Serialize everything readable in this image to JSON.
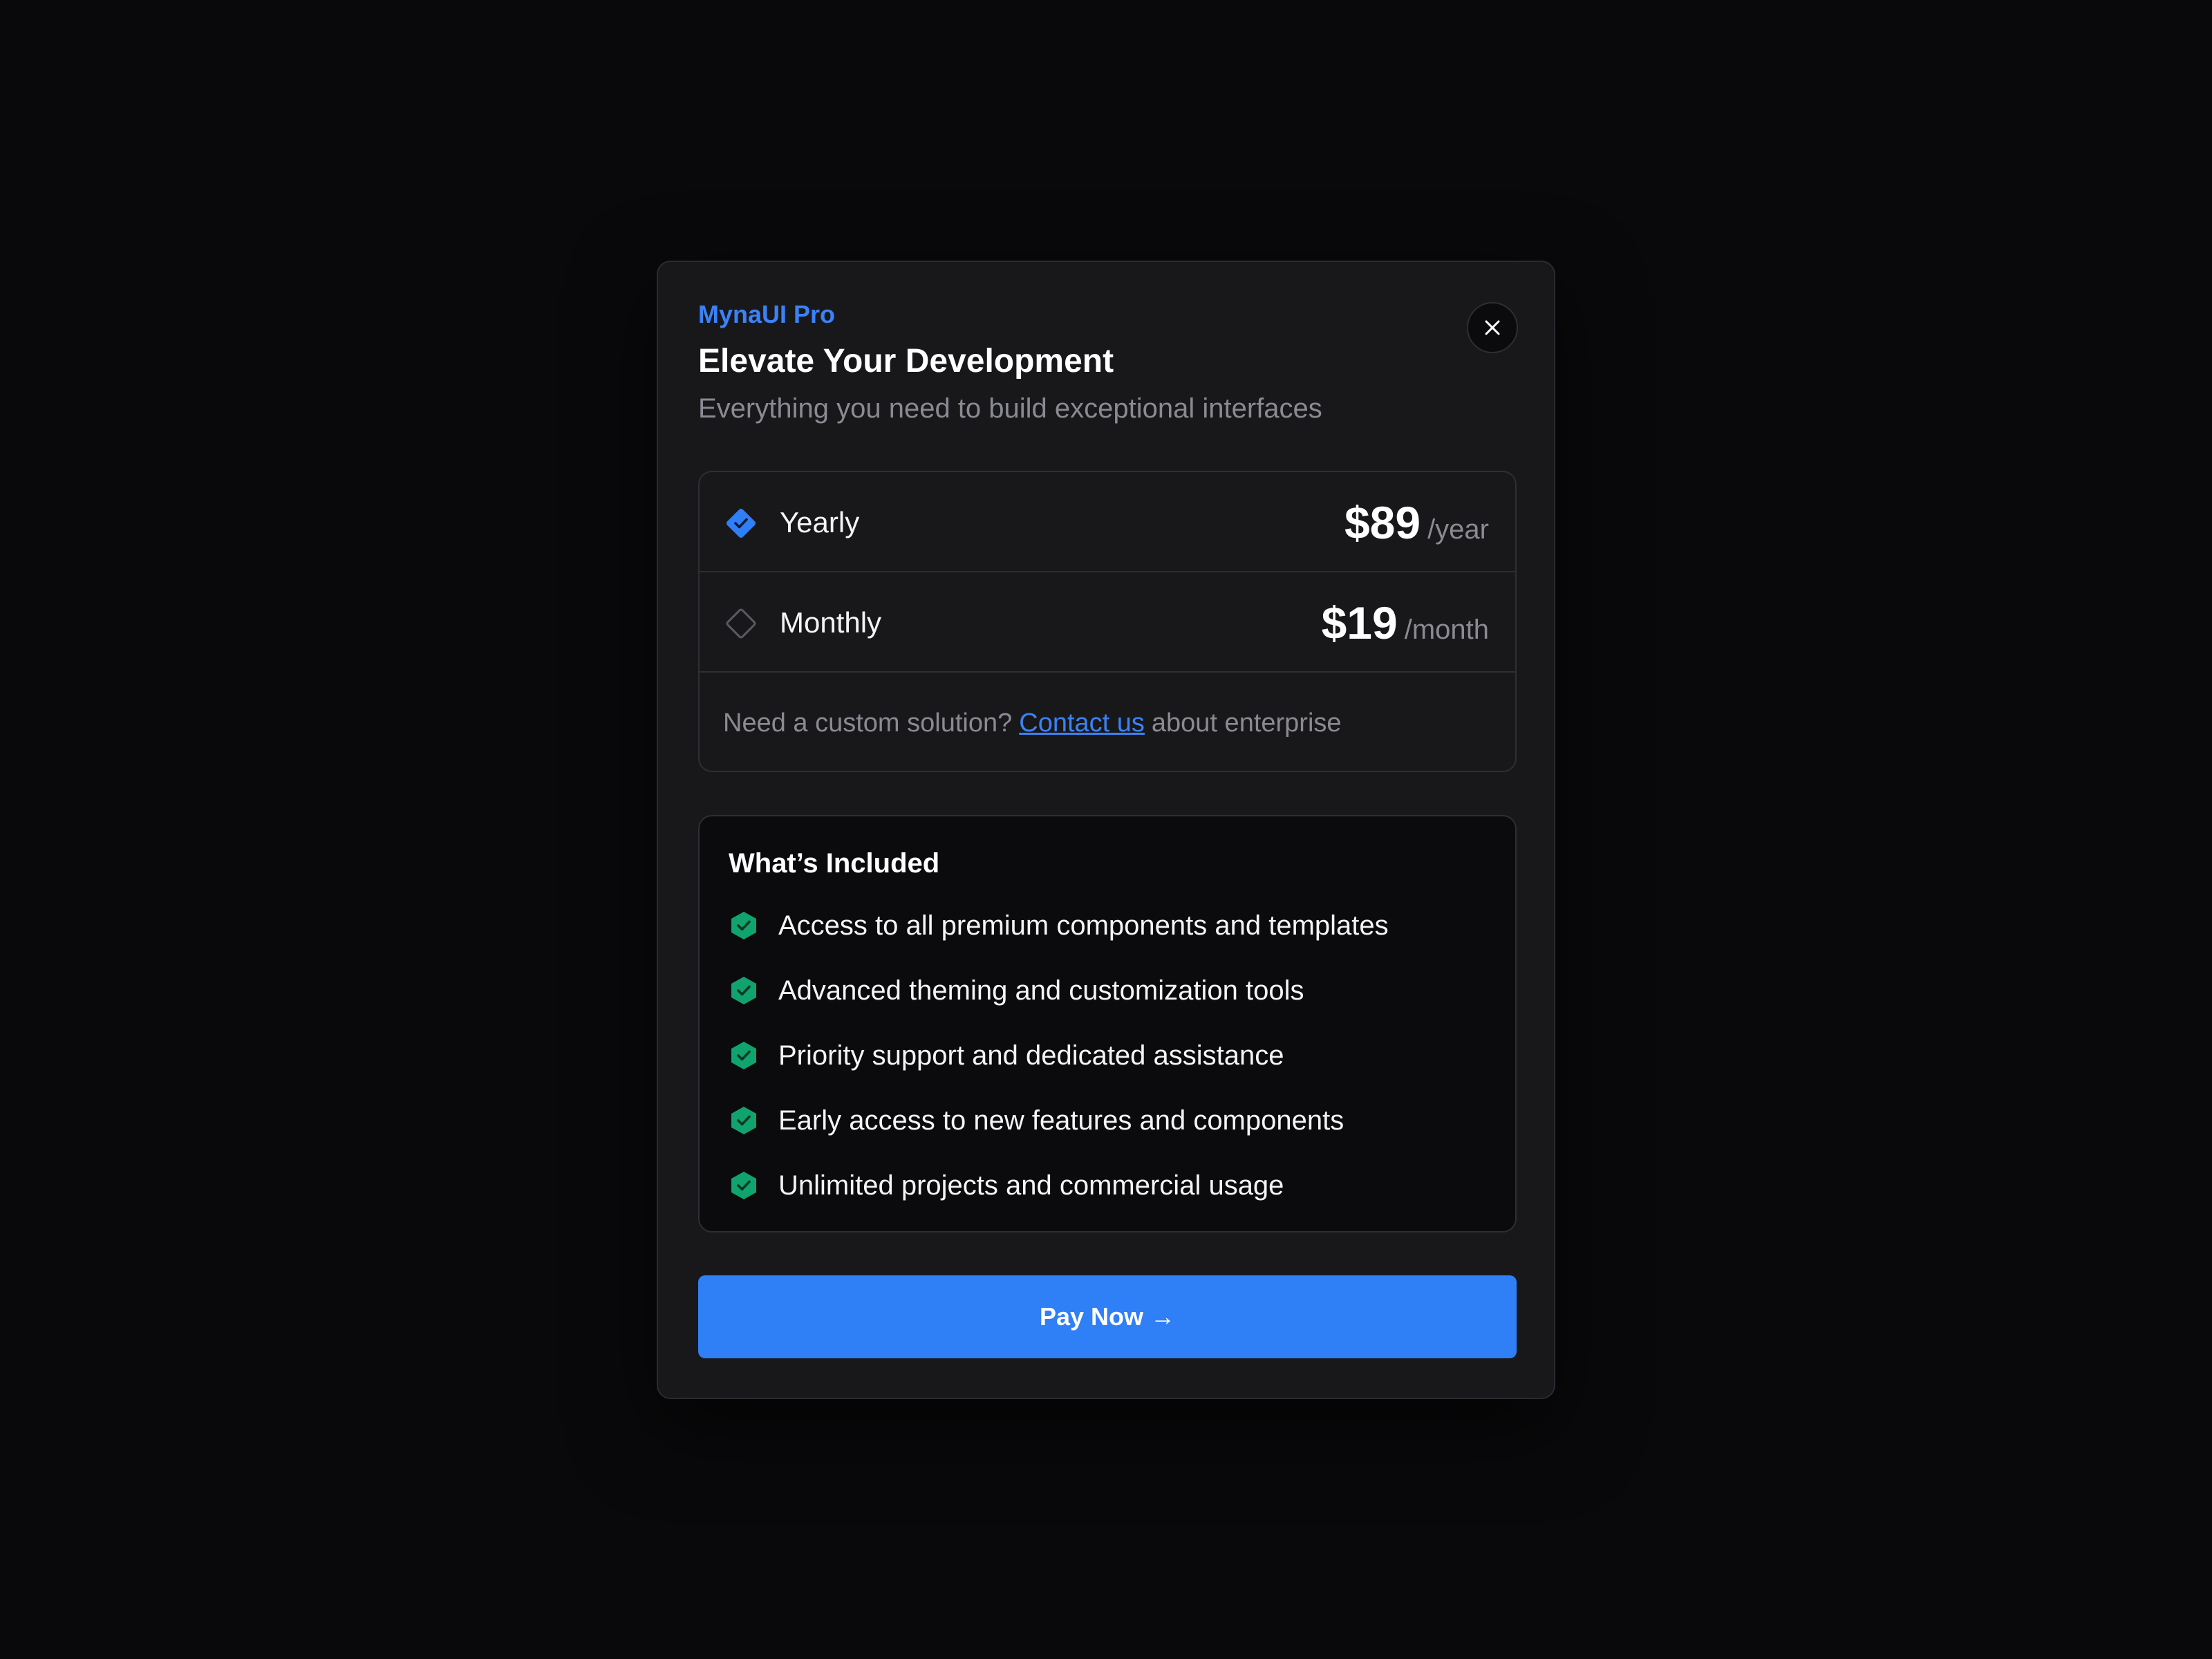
{
  "modal": {
    "brand": "MynaUI Pro",
    "title": "Elevate Your Development",
    "subtitle": "Everything you need to build exceptional interfaces",
    "close_icon": "x-icon"
  },
  "plans": [
    {
      "name": "Yearly",
      "price": "$89",
      "period": "/year",
      "selected": true
    },
    {
      "name": "Monthly",
      "price": "$19",
      "period": "/month",
      "selected": false
    }
  ],
  "custom": {
    "prefix": "Need a custom solution?",
    "link": "Contact us",
    "suffix": "about enterprise"
  },
  "included": {
    "title": "What’s Included",
    "icon": "shield-check-icon",
    "items": [
      "Access to all premium components and templates",
      "Advanced theming and customization tools",
      "Priority support and dedicated assistance",
      "Early access to new features and components",
      "Unlimited projects and commercial usage"
    ]
  },
  "pay_button": {
    "label": "Pay Now →"
  },
  "colors": {
    "accent": "#2f7ff7",
    "success": "#10a36e",
    "background": "#09090b",
    "surface": "#18181b"
  }
}
